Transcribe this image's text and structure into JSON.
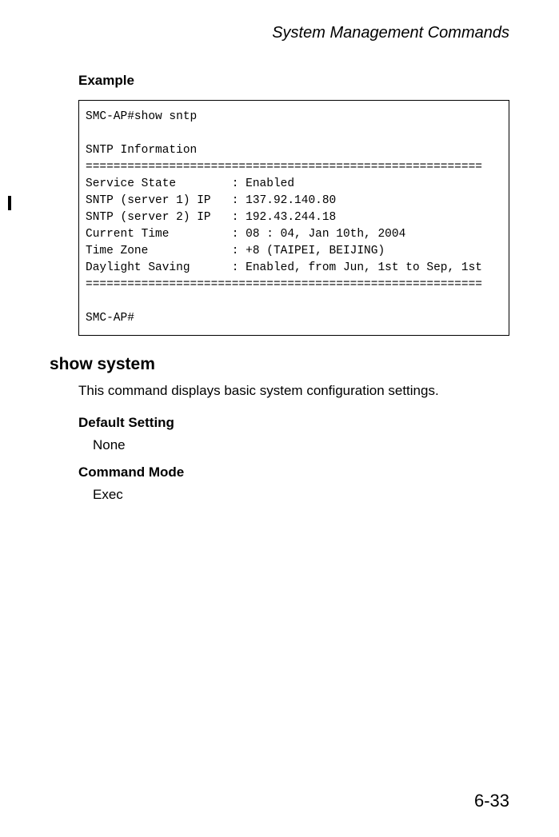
{
  "header": {
    "title": "System Management Commands"
  },
  "example": {
    "label": "Example",
    "code": "SMC-AP#show sntp\n\nSNTP Information\n=========================================================\nService State        : Enabled\nSNTP (server 1) IP   : 137.92.140.80\nSNTP (server 2) IP   : 192.43.244.18\nCurrent Time         : 08 : 04, Jan 10th, 2004\nTime Zone            : +8 (TAIPEI, BEIJING)\nDaylight Saving      : Enabled, from Jun, 1st to Sep, 1st\n=========================================================\n\nSMC-AP#"
  },
  "section": {
    "title": "show system",
    "description": "This command displays basic system configuration settings.",
    "default_setting_label": "Default Setting",
    "default_setting_value": "None",
    "command_mode_label": "Command Mode",
    "command_mode_value": "Exec"
  },
  "footer": {
    "page_number": "6-33"
  }
}
